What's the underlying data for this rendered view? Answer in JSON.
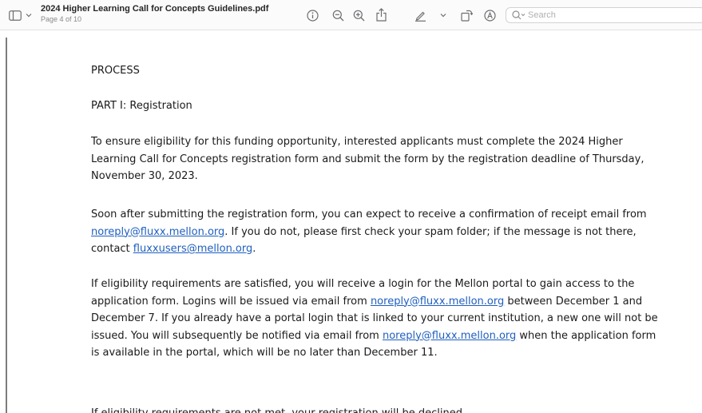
{
  "toolbar": {
    "document_title": "2024 Higher Learning Call for Concepts Guidelines.pdf",
    "page_indicator": "Page 4 of 10",
    "search_placeholder": "Search",
    "icons": [
      "sidebar-icon",
      "chevron-down-icon",
      "info-icon",
      "zoom-out-icon",
      "zoom-in-icon",
      "share-icon",
      "highlight-pen-icon",
      "chevron-down-icon",
      "rotate-icon",
      "markup-icon",
      "search-icon"
    ]
  },
  "document": {
    "section_heading": "PROCESS",
    "part_heading": "PART I: Registration",
    "paragraphs": [
      {
        "segments": [
          {
            "text": "To ensure eligibility for this funding opportunity, interested applicants must complete the 2024 Higher Learning Call for Concepts registration form and submit the form by the registration deadline of Thursday, November 30, 2023."
          }
        ]
      },
      {
        "segments": [
          {
            "text": "Soon after submitting the registration form, you can expect to receive a confirmation of receipt email from "
          },
          {
            "text": "noreply@fluxx.mellon.org",
            "link": true
          },
          {
            "text": ". If you do not, please first check your spam folder; if the message is not there, contact "
          },
          {
            "text": "fluxxusers@mellon.org",
            "link": true
          },
          {
            "text": "."
          }
        ]
      },
      {
        "segments": [
          {
            "text": "If eligibility requirements are satisfied, you will receive a login for the Mellon portal to gain access to the application form. Logins will be issued via email from "
          },
          {
            "text": "noreply@fluxx.mellon.org",
            "link": true
          },
          {
            "text": " between December 1 and December 7. If you already have a portal login that is linked to your current institution, a new one will not be issued. You will subsequently be notified via email from "
          },
          {
            "text": "noreply@fluxx.mellon.org",
            "link": true
          },
          {
            "text": " when the application form is available in the portal, which will be no later than December 11."
          }
        ]
      },
      {
        "segments": [
          {
            "text": "If eligibility requirements are not met, your registration will be declined."
          }
        ]
      }
    ]
  },
  "colors": {
    "link": "#1f5fbf",
    "toolbar_bg": "#fbfbfb",
    "icon": "#6e6e73",
    "left_rule": "#7c7c7c"
  }
}
